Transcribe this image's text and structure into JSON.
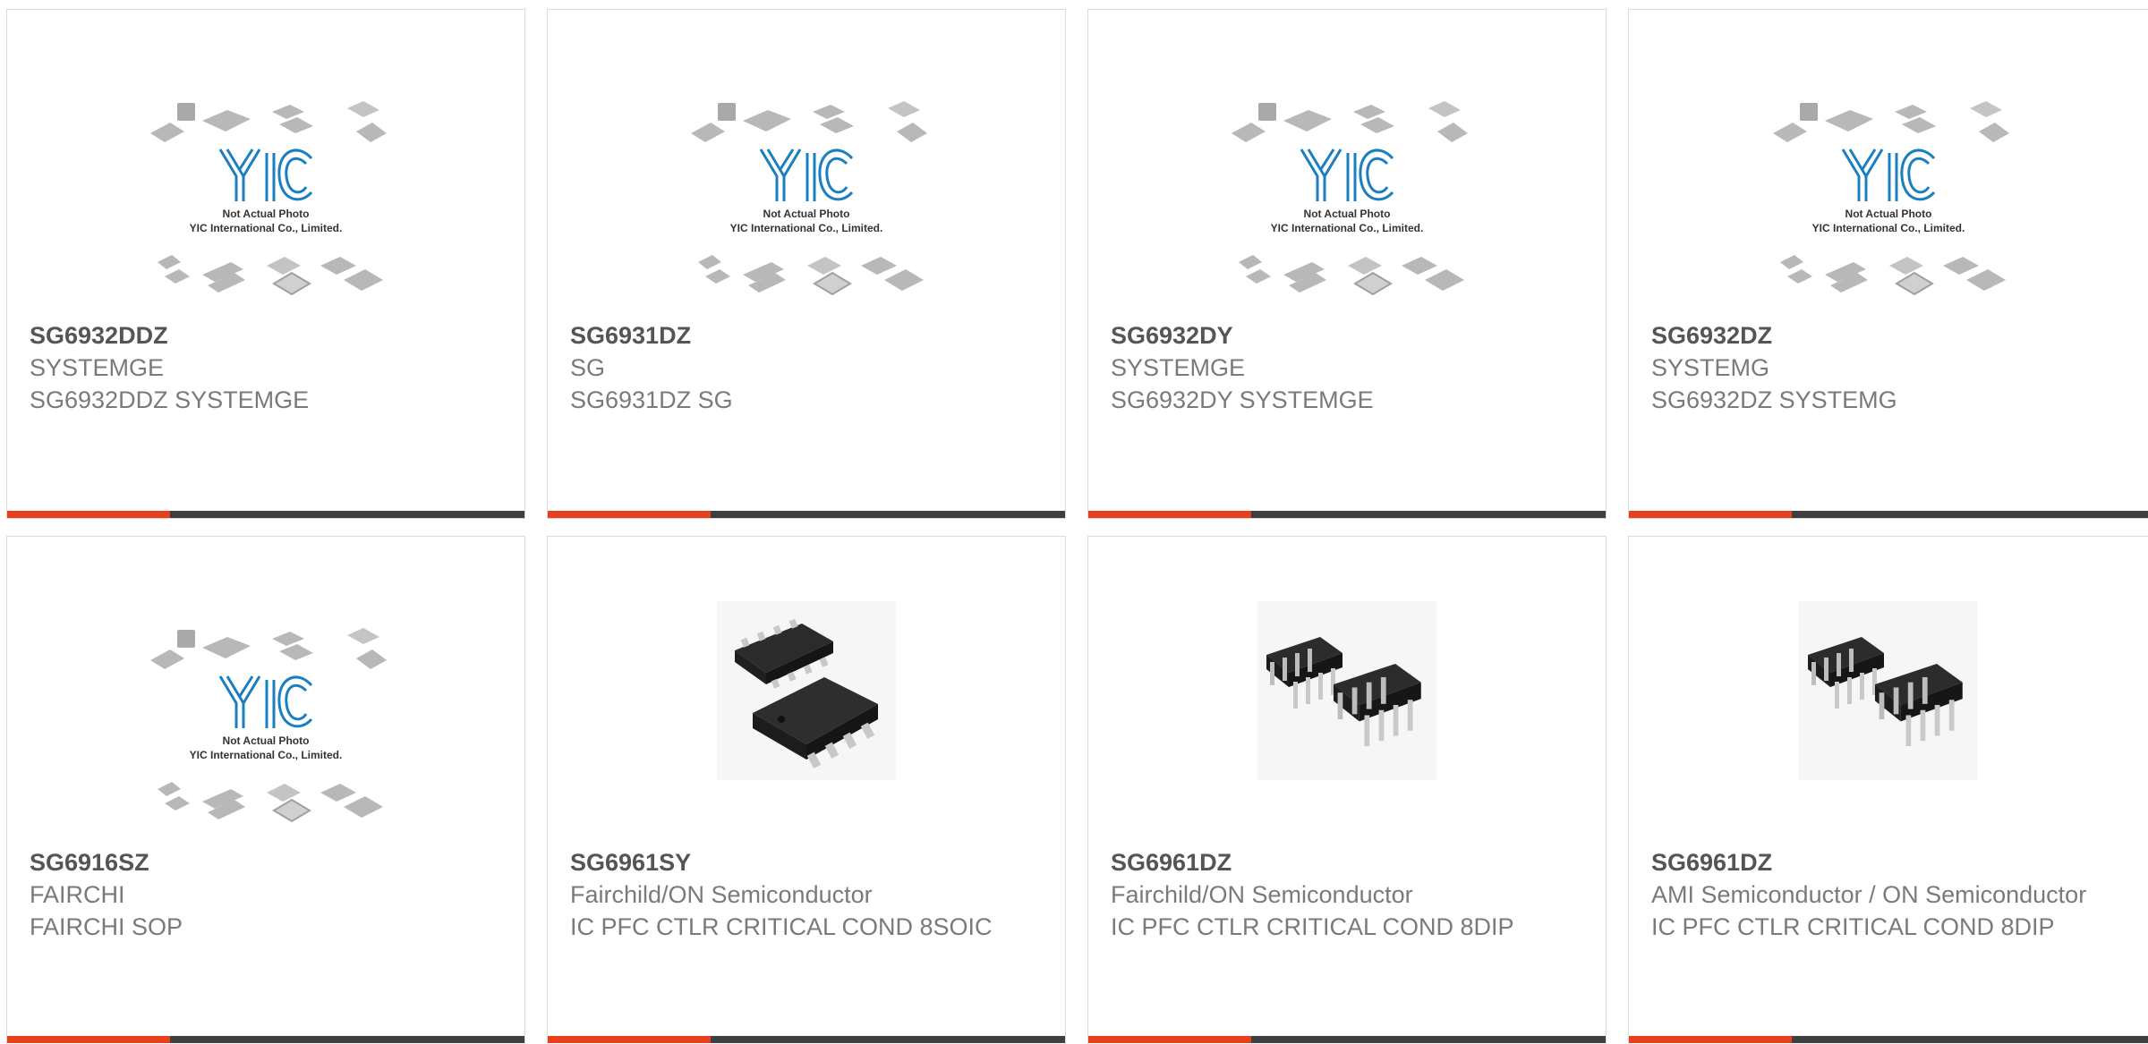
{
  "placeholder_image": {
    "line1": "Not Actual Photo",
    "line2": "YIC International Co., Limited.",
    "logo_text": "YIC"
  },
  "colors": {
    "accent": "#e8401c",
    "bar": "#3f3f3f",
    "part_number": "#555555",
    "secondary_text": "#7a7a7a",
    "logo_blue": "#1a7fc1"
  },
  "products": [
    {
      "part_number": "SG6932DDZ",
      "manufacturer": "SYSTEMGE",
      "description": "SG6932DDZ SYSTEMGE",
      "image": "placeholder-photo"
    },
    {
      "part_number": "SG6931DZ",
      "manufacturer": "SG",
      "description": "SG6931DZ SG",
      "image": "placeholder-photo"
    },
    {
      "part_number": "SG6932DY",
      "manufacturer": "SYSTEMGE",
      "description": "SG6932DY SYSTEMGE",
      "image": "placeholder-photo"
    },
    {
      "part_number": "SG6932DZ",
      "manufacturer": "SYSTEMG",
      "description": "SG6932DZ SYSTEMG",
      "image": "placeholder-photo"
    },
    {
      "part_number": "SG6916SZ",
      "manufacturer": "FAIRCHI",
      "description": "FAIRCHI SOP",
      "image": "placeholder-photo"
    },
    {
      "part_number": "SG6961SY",
      "manufacturer": "Fairchild/ON Semiconductor",
      "description": "IC PFC CTLR CRITICAL COND 8SOIC",
      "image": "soic-8-chip"
    },
    {
      "part_number": "SG6961DZ",
      "manufacturer": "Fairchild/ON Semiconductor",
      "description": "IC PFC CTLR CRITICAL COND 8DIP",
      "image": "dip-8-chip"
    },
    {
      "part_number": "SG6961DZ",
      "manufacturer": "AMI Semiconductor / ON Semiconductor",
      "description": "IC PFC CTLR CRITICAL COND 8DIP",
      "image": "dip-8-chip"
    }
  ]
}
